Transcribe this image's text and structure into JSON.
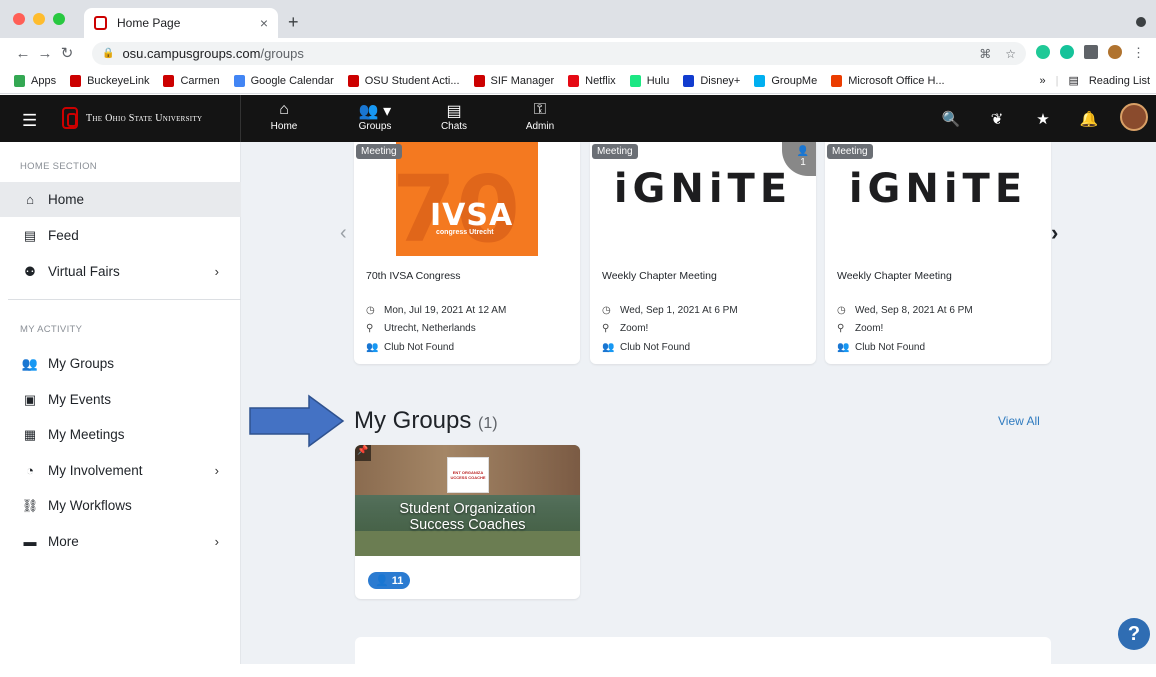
{
  "browser": {
    "tab_title": "Home Page",
    "tab_close": "×",
    "new_tab": "+",
    "url_host": "osu.campusgroups.com",
    "url_path": "/groups",
    "bookmarks": [
      {
        "label": "Apps",
        "color": "#34a853"
      },
      {
        "label": "BuckeyeLink",
        "color": "#cc0000"
      },
      {
        "label": "Carmen",
        "color": "#cc0000"
      },
      {
        "label": "Google Calendar",
        "color": "#4285f4"
      },
      {
        "label": "OSU Student Acti...",
        "color": "#cc0000"
      },
      {
        "label": "SIF Manager",
        "color": "#cc0000"
      },
      {
        "label": "Netflix",
        "color": "#e50914"
      },
      {
        "label": "Hulu",
        "color": "#1ce783"
      },
      {
        "label": "Disney+",
        "color": "#113ccf"
      },
      {
        "label": "GroupMe",
        "color": "#00aff0"
      },
      {
        "label": "Microsoft Office H...",
        "color": "#eb3c00"
      }
    ],
    "more_bookmarks": "»",
    "reading_list": "Reading List"
  },
  "header": {
    "university": "The Ohio State University",
    "nav": [
      {
        "label": "Home",
        "icon": "home-icon"
      },
      {
        "label": "Groups",
        "icon": "groups-icon"
      },
      {
        "label": "Chats",
        "icon": "chat-icon"
      },
      {
        "label": "Admin",
        "icon": "key-icon"
      }
    ]
  },
  "sidebar": {
    "home_section": "HOME SECTION",
    "home_items": [
      {
        "label": "Home",
        "icon": "home-icon"
      },
      {
        "label": "Feed",
        "icon": "feed-icon"
      },
      {
        "label": "Virtual Fairs",
        "icon": "virtual-fairs-icon"
      }
    ],
    "activity_section": "MY ACTIVITY",
    "activity_items": [
      {
        "label": "My Groups",
        "icon": "groups-icon"
      },
      {
        "label": "My Events",
        "icon": "calendar-icon"
      },
      {
        "label": "My Meetings",
        "icon": "meetings-icon"
      },
      {
        "label": "My Involvement",
        "icon": "involvement-icon"
      },
      {
        "label": "My Workflows",
        "icon": "workflow-icon"
      },
      {
        "label": "More",
        "icon": "more-icon"
      }
    ]
  },
  "events": [
    {
      "badge": "Meeting",
      "title": "70th IVSA Congress",
      "date": "Mon, Jul 19, 2021 At 12 AM",
      "location": "Utrecht, Netherlands",
      "club": "Club Not Found",
      "image_text": "IVSA",
      "image_sub": "congress Utrecht",
      "image_num": "70"
    },
    {
      "badge": "Meeting",
      "title": "Weekly Chapter Meeting",
      "date": "Wed, Sep 1, 2021 At 6 PM",
      "location": "Zoom!",
      "club": "Club Not Found",
      "image_text": "iGNiTE",
      "corner_count": "1"
    },
    {
      "badge": "Meeting",
      "title": "Weekly Chapter Meeting",
      "date": "Wed, Sep 8, 2021 At 6 PM",
      "location": "Zoom!",
      "club": "Club Not Found",
      "image_text": "iGNiTE"
    }
  ],
  "my_groups": {
    "title": "My Groups",
    "count": "(1)",
    "view_all": "View All",
    "group": {
      "name_line1": "Student Organization",
      "name_line2": "Success Coaches",
      "sign_line1": "ENT ORGANIZA",
      "sign_line2": "UCCESS COACHE",
      "members": "11"
    }
  },
  "help": "?"
}
